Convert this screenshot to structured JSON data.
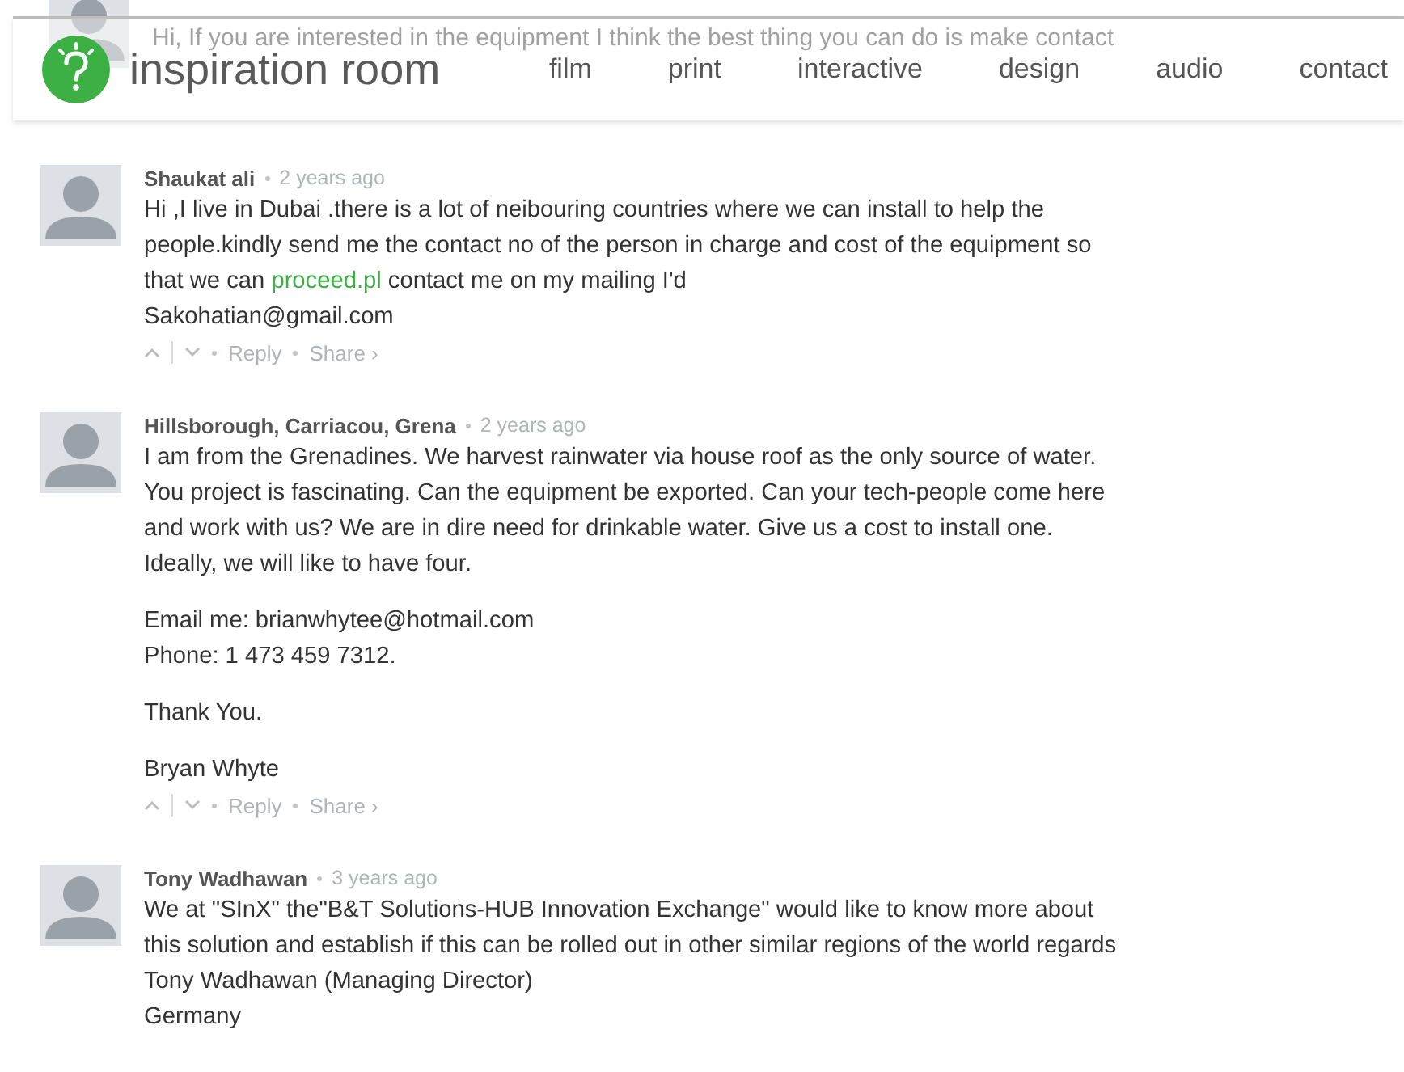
{
  "header": {
    "logo_text": "inspiration room",
    "nav": [
      {
        "label": "film"
      },
      {
        "label": "print"
      },
      {
        "label": "interactive"
      },
      {
        "label": "design"
      },
      {
        "label": "audio"
      },
      {
        "label": "contact"
      }
    ]
  },
  "partial_comment": {
    "text": "Hi, If you are interested in the equipment I think the best thing you can do is make contact"
  },
  "comments": [
    {
      "author": "Shaukat ali",
      "time": "2 years ago",
      "blocks": [
        {
          "lines": [
            [
              {
                "text": "Hi ,I live in Dubai .there is a lot of neibouring countries where we can install to help the people.kindly send me the contact no of the person in charge and cost of the equipment so that we can "
              },
              {
                "text": "proceed.pl",
                "kind": "link"
              },
              {
                "text": " contact me on my mailing I'd"
              }
            ],
            [
              {
                "text": "Sakohatian@gmail.com"
              }
            ]
          ]
        }
      ],
      "actions": [
        "Reply",
        "Share ›"
      ]
    },
    {
      "author": "Hillsborough, Carriacou, Grena",
      "time": "2 years ago",
      "blocks": [
        {
          "lines": [
            [
              {
                "text": "I am from the Grenadines. We harvest rainwater via house roof as the only source of water. You project is fascinating. Can the equipment be exported. Can your tech-people come here and work with us? We are in dire need for drinkable water. Give us a cost to install one. Ideally, we will like to have four."
              }
            ]
          ]
        },
        {
          "lines": [
            [
              {
                "text": "Email me: brianwhytee@hotmail.com"
              }
            ],
            [
              {
                "text": "Phone: 1 473 459 7312."
              }
            ]
          ]
        },
        {
          "lines": [
            [
              {
                "text": "Thank You."
              }
            ]
          ]
        },
        {
          "lines": [
            [
              {
                "text": "Bryan Whyte"
              }
            ]
          ]
        }
      ],
      "actions": [
        "Reply",
        "Share ›"
      ]
    },
    {
      "author": "Tony Wadhawan",
      "time": "3 years ago",
      "blocks": [
        {
          "lines": [
            [
              {
                "text": "We at \"SInX\" the\"B&T Solutions-HUB Innovation Exchange\" would like to know more about this solution and establish if this can be rolled out in other similar regions of the world regards"
              }
            ],
            [
              {
                "text": "Tony Wadhawan (Managing Director)"
              }
            ],
            [
              {
                "text": "Germany"
              }
            ]
          ]
        }
      ]
    }
  ]
}
